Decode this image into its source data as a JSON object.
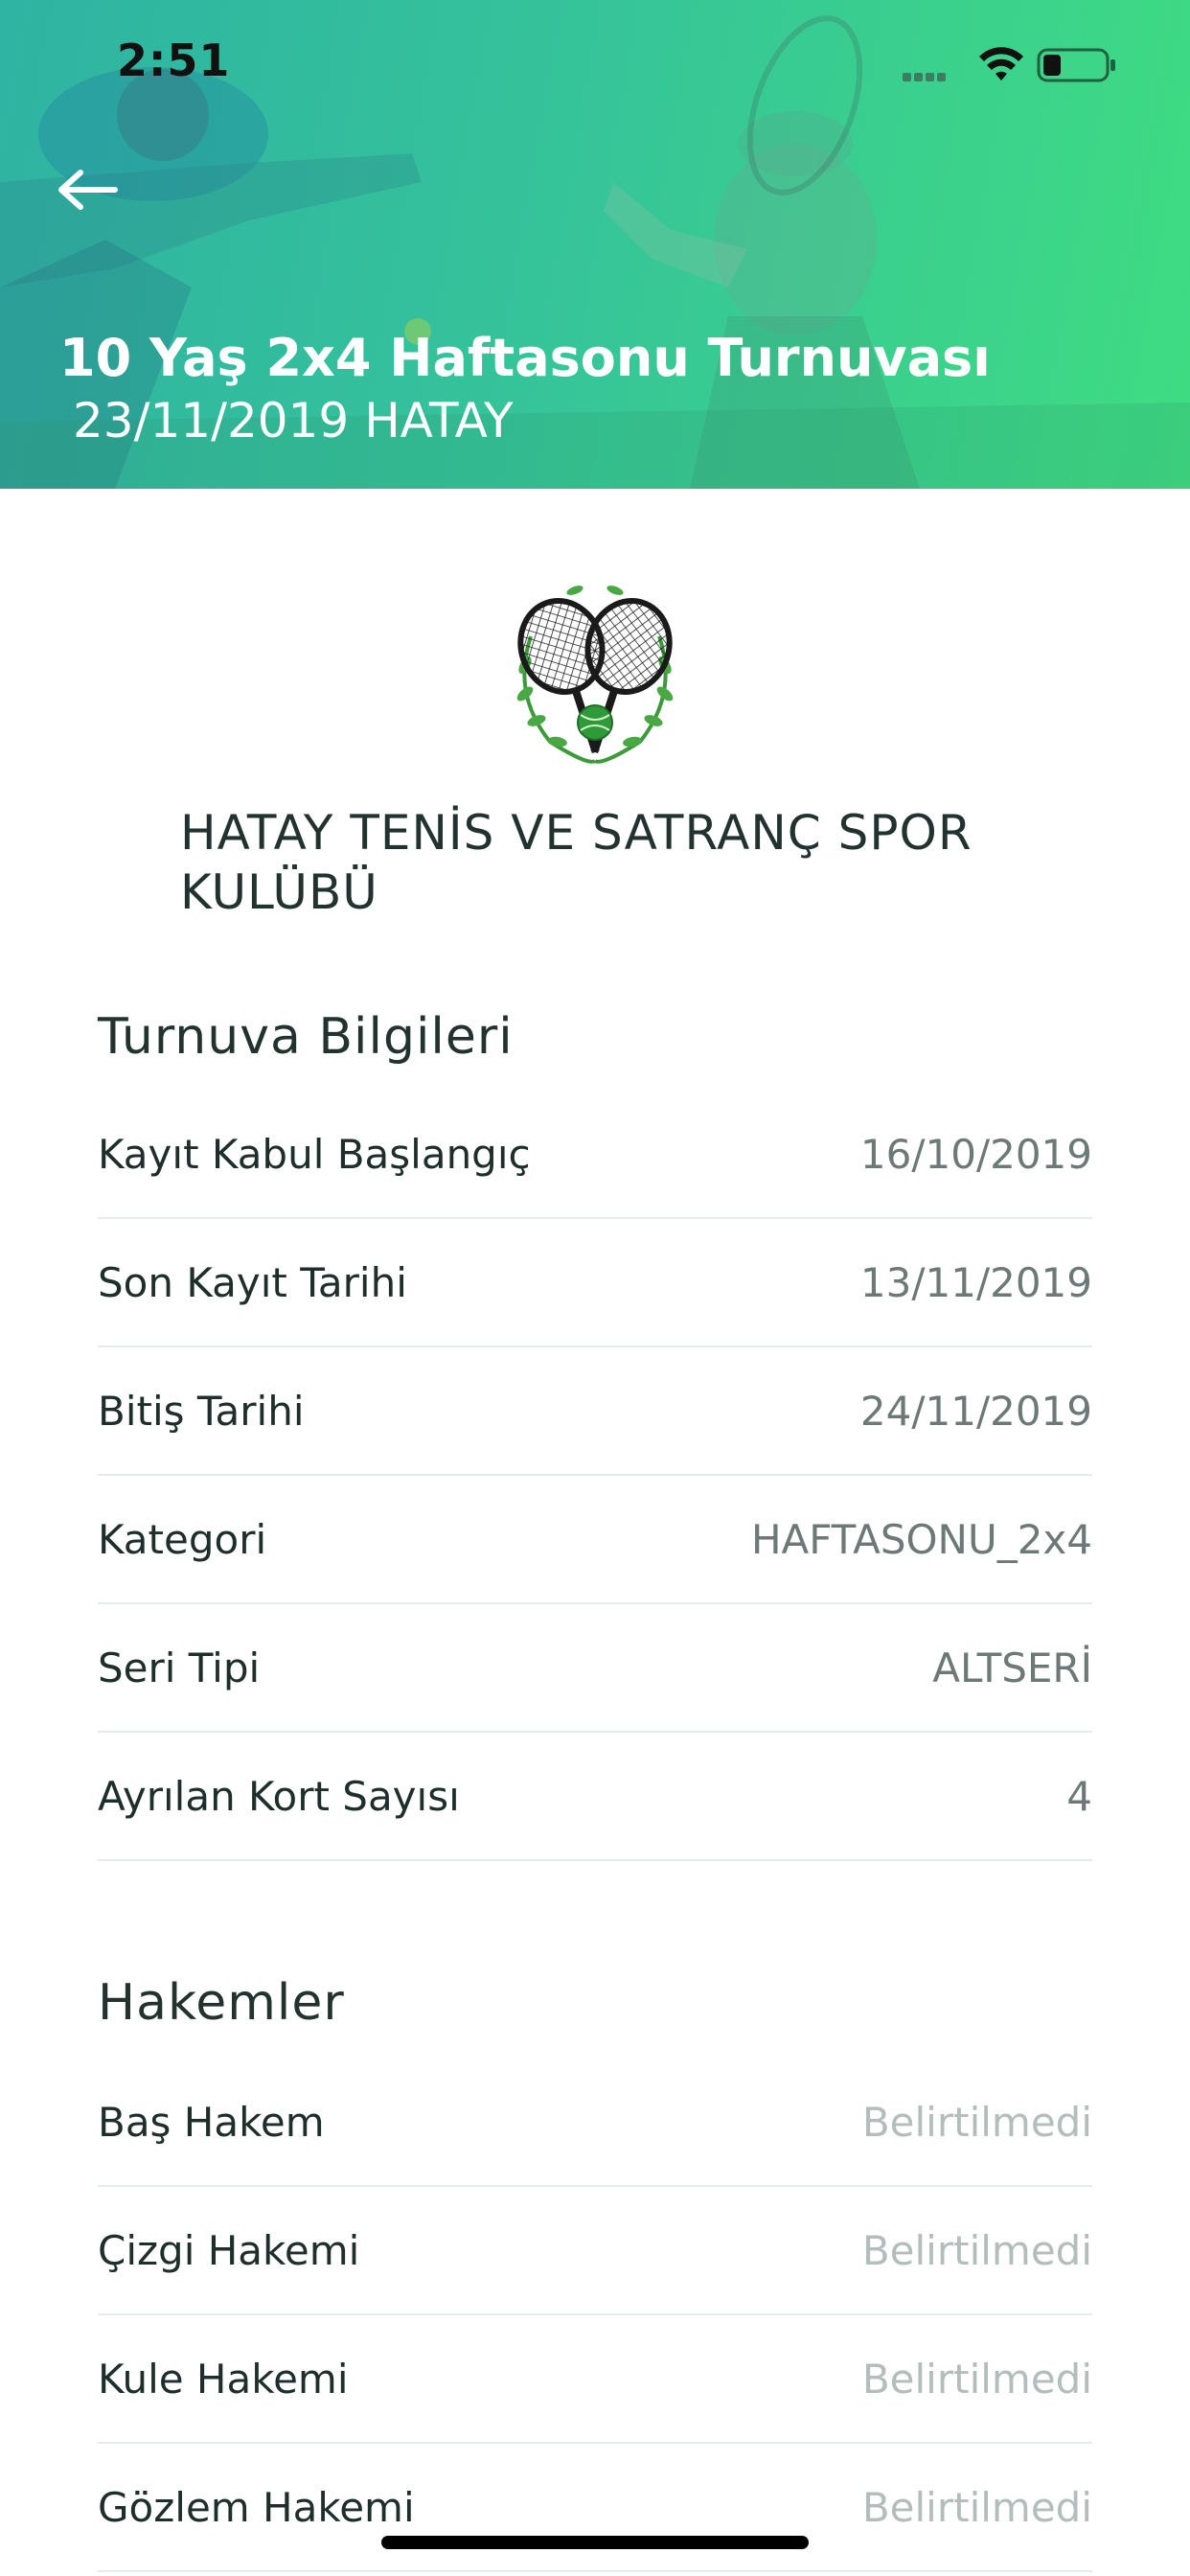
{
  "status_bar": {
    "time": "2:51"
  },
  "header": {
    "title": "10 Yaş 2x4 Haftasonu Turnuvası",
    "subtitle": "23/11/2019 HATAY",
    "gradient_start": "#2fb3a3",
    "gradient_end": "#3fdc82",
    "back_icon": "arrow-left-icon"
  },
  "club": {
    "name": "HATAY TENİS VE SATRANÇ SPOR KULÜBÜ",
    "logo_icon": "crossed-tennis-rackets-icon"
  },
  "tournament_info": {
    "title": "Turnuva Bilgileri",
    "rows": [
      {
        "label": "Kayıt Kabul Başlangıç",
        "value": "16/10/2019"
      },
      {
        "label": "Son Kayıt Tarihi",
        "value": "13/11/2019"
      },
      {
        "label": "Bitiş Tarihi",
        "value": "24/11/2019"
      },
      {
        "label": "Kategori",
        "value": "HAFTASONU_2x4"
      },
      {
        "label": "Seri Tipi",
        "value": "ALTSERİ"
      },
      {
        "label": "Ayrılan Kort Sayısı",
        "value": "4"
      }
    ]
  },
  "referees": {
    "title": "Hakemler",
    "rows": [
      {
        "label": "Baş Hakem",
        "value": "Belirtilmedi"
      },
      {
        "label": "Çizgi Hakemi",
        "value": "Belirtilmedi"
      },
      {
        "label": "Kule Hakemi",
        "value": "Belirtilmedi"
      },
      {
        "label": "Gözlem Hakemi",
        "value": "Belirtilmedi"
      }
    ]
  }
}
